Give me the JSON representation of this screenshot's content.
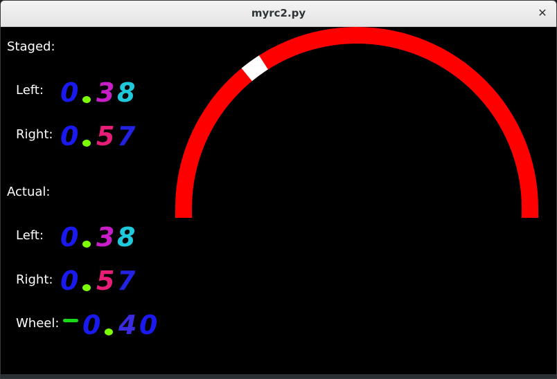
{
  "window": {
    "title": "myrc2.py",
    "close_glyph": "✕"
  },
  "labels": {
    "staged": "Staged:",
    "staged_left": "Left:",
    "staged_right": "Right:",
    "actual": "Actual:",
    "actual_left": "Left:",
    "actual_right": "Right:",
    "wheel": "Wheel:"
  },
  "values": {
    "staged_left": "0.38",
    "staged_right": "0.57",
    "actual_left": "0.38",
    "actual_right": "0.57",
    "wheel": "-0.40"
  },
  "gauge": {
    "arc_color": "#ff0000",
    "marker_color": "#ffffff",
    "steering_value": -0.4
  },
  "digit_colors": {
    "0": "#1a1af0",
    "3": "#c81ec8",
    "8": "#20c8dc",
    "5": "#e61e78",
    "7": "#2222e0",
    "4": "#3a2ae0",
    ".": "#7cff00",
    "-": "#18d818"
  }
}
